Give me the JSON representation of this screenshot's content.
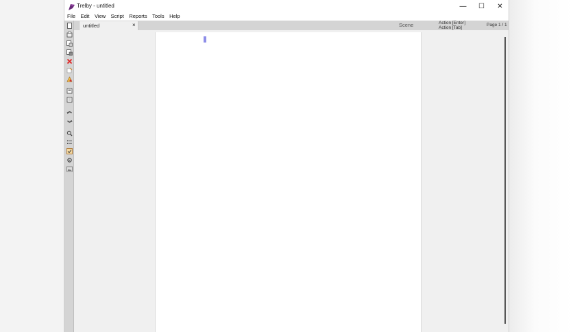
{
  "window": {
    "title": "Trelby - untitled",
    "caption": {
      "minimize": "—",
      "maximize": "☐",
      "close": "✕"
    }
  },
  "menu": [
    "File",
    "Edit",
    "View",
    "Script",
    "Reports",
    "Tools",
    "Help"
  ],
  "toolbar": {
    "tools": [
      "new-icon",
      "open-icon",
      "save-icon",
      "save-as-icon",
      "close-icon",
      "export-icon",
      "print-icon",
      "script-settings-icon",
      "import-icon",
      "undo-icon",
      "redo-icon",
      "find-icon",
      "list-icon",
      "spellcheck-icon",
      "settings-icon",
      "screenshot-icon"
    ]
  },
  "tabs": [
    {
      "label": "untitled",
      "close": "×"
    }
  ],
  "status": {
    "element_type": "Scene",
    "hint_enter": "Action [Enter]",
    "hint_tab": "Action [Tab]",
    "page": "Page 1 / 1"
  },
  "colors": {
    "accent": "#8e8ee8",
    "app_icon": "#6a2a7a",
    "close_red": "#e02020",
    "toolbar_bg": "#d4d4d4"
  }
}
